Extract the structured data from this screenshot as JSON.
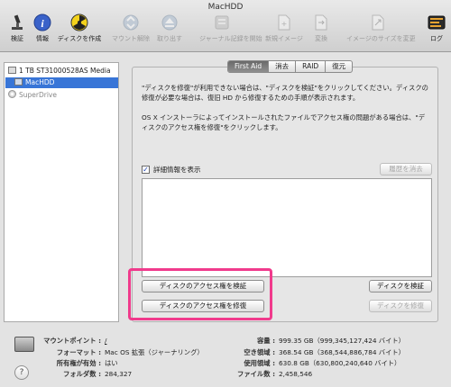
{
  "window": {
    "title": "MacHDD"
  },
  "toolbar": {
    "items": [
      {
        "label": "検証",
        "icon": "microscope-icon"
      },
      {
        "label": "情報",
        "icon": "info-icon"
      },
      {
        "label": "ディスクを作成",
        "icon": "radiation-icon"
      },
      {
        "label": "マウント解除",
        "icon": "unmount-icon"
      },
      {
        "label": "取り出す",
        "icon": "eject-icon"
      },
      {
        "label": "ジャーナル記録を開始",
        "icon": "journal-icon"
      },
      {
        "label": "新規イメージ",
        "icon": "new-image-icon"
      },
      {
        "label": "変換",
        "icon": "convert-icon"
      },
      {
        "label": "イメージのサイズを変更",
        "icon": "resize-image-icon"
      },
      {
        "label": "ログ",
        "icon": "log-icon"
      }
    ]
  },
  "sidebar": {
    "disk": "1 TB ST31000528AS Media",
    "volume": "MacHDD",
    "optical": "SuperDrive"
  },
  "tabs": [
    "First Aid",
    "消去",
    "RAID",
    "復元"
  ],
  "main": {
    "para1": "\"ディスクを修復\"が利用できない場合は、\"ディスクを検証\"をクリックしてください。ディスクの修復が必要な場合は、復旧 HD から修復するための手順が表示されます。",
    "para2": "OS X インストーラによってインストールされたファイルでアクセス権の問題がある場合は、\"ディスクのアクセス権を修復\"をクリックします。",
    "show_details": "詳細情報を表示",
    "show_details_checked": true,
    "clear_history": "履歴を消去",
    "verify_permissions": "ディスクのアクセス権を検証",
    "repair_permissions": "ディスクのアクセス権を修復",
    "verify_disk": "ディスクを検証",
    "repair_disk": "ディスクを修復"
  },
  "info": {
    "mount_point_label": "マウントポイント :",
    "mount_point_value": "/",
    "format_label": "フォーマット :",
    "format_value": "Mac OS 拡張（ジャーナリング）",
    "owners_label": "所有権が有効 :",
    "owners_value": "はい",
    "folders_label": "フォルダ数 :",
    "folders_value": "284,327",
    "capacity_label": "容量 :",
    "capacity_value": "999.35 GB（999,345,127,424 バイト）",
    "available_label": "空き領域 :",
    "available_value": "368.54 GB（368,544,886,784 バイト）",
    "used_label": "使用領域 :",
    "used_value": "630.8 GB（630,800,240,640 バイト）",
    "files_label": "ファイル数 :",
    "files_value": "2,458,546"
  },
  "colors": {
    "selection": "#3875d7",
    "highlight": "#f03a8c",
    "link": "#1747c0"
  }
}
